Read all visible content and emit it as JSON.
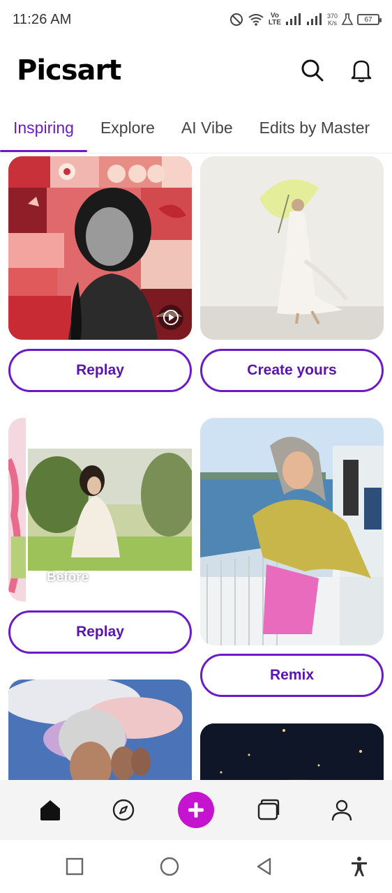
{
  "status_bar": {
    "time": "11:26 AM",
    "net_speed_value": "370",
    "net_speed_unit": "K/s",
    "volte_top": "Vo",
    "volte_bottom": "LTE",
    "battery": "67"
  },
  "header": {
    "brand": "Picsart",
    "icons": [
      "search-icon",
      "bell-icon"
    ]
  },
  "tabs": [
    {
      "label": "Inspiring",
      "active": true
    },
    {
      "label": "Explore",
      "active": false
    },
    {
      "label": "AI Vibe",
      "active": false
    },
    {
      "label": "Edits by Master",
      "active": false
    }
  ],
  "feed": {
    "card1_button": "Replay",
    "card2_button": "Create yours",
    "card3_button": "Replay",
    "card3_overlay": "Before",
    "card4_button": "Remix"
  },
  "bottom_nav": {
    "items": [
      "home-icon",
      "compass-icon",
      "plus-icon",
      "folder-icon",
      "profile-icon"
    ],
    "accent": "#c414cf"
  },
  "colors": {
    "accent": "#6a1bc7"
  }
}
